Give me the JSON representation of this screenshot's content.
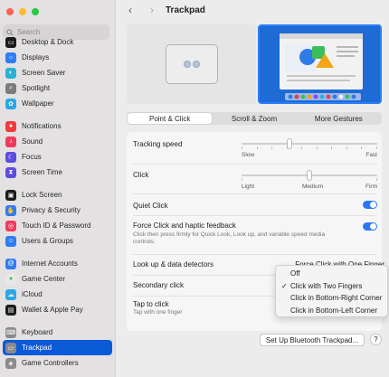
{
  "window": {
    "title": "Trackpad"
  },
  "sidebar": {
    "search_placeholder": "Search",
    "groups": [
      [
        {
          "label": "Desktop & Dock",
          "icon": "dock-icon",
          "color": "#1b1b1b"
        },
        {
          "label": "Displays",
          "icon": "display-icon",
          "color": "#2f7cf6"
        },
        {
          "label": "Screen Saver",
          "icon": "screensaver-icon",
          "color": "#29b2d6"
        },
        {
          "label": "Spotlight",
          "icon": "magnifier-icon",
          "color": "#7c7c7c"
        },
        {
          "label": "Wallpaper",
          "icon": "flower-icon",
          "color": "#2aa7e8"
        }
      ],
      [
        {
          "label": "Notifications",
          "icon": "bell-icon",
          "color": "#ef3b3b"
        },
        {
          "label": "Sound",
          "icon": "speaker-icon",
          "color": "#ef3b5a"
        },
        {
          "label": "Focus",
          "icon": "moon-icon",
          "color": "#5b4de0"
        },
        {
          "label": "Screen Time",
          "icon": "hourglass-icon",
          "color": "#5b4de0"
        }
      ],
      [
        {
          "label": "Lock Screen",
          "icon": "lock-screen-icon",
          "color": "#1b1b1b"
        },
        {
          "label": "Privacy & Security",
          "icon": "hand-icon",
          "color": "#2f7cf6"
        },
        {
          "label": "Touch ID & Password",
          "icon": "fingerprint-icon",
          "color": "#ef3b5a"
        },
        {
          "label": "Users & Groups",
          "icon": "users-icon",
          "color": "#2f7cf6"
        }
      ],
      [
        {
          "label": "Internet Accounts",
          "icon": "at-icon",
          "color": "#2f7cf6"
        },
        {
          "label": "Game Center",
          "icon": "game-center-icon",
          "color": "#e8e8e8"
        },
        {
          "label": "iCloud",
          "icon": "cloud-icon",
          "color": "#2aa7e8"
        },
        {
          "label": "Wallet & Apple Pay",
          "icon": "wallet-icon",
          "color": "#1b1b1b"
        }
      ],
      [
        {
          "label": "Keyboard",
          "icon": "keyboard-icon",
          "color": "#8a8a8a"
        },
        {
          "label": "Trackpad",
          "icon": "trackpad-icon",
          "color": "#8a8a8a",
          "active": true
        },
        {
          "label": "Game Controllers",
          "icon": "gamepad-icon",
          "color": "#8a8a8a"
        }
      ]
    ]
  },
  "tabs": [
    "Point & Click",
    "Scroll & Zoom",
    "More Gestures"
  ],
  "selected_tab": 0,
  "settings": {
    "tracking_speed": {
      "label": "Tracking speed",
      "min_label": "Slow",
      "max_label": "Fast",
      "value": 0.35
    },
    "click": {
      "label": "Click",
      "labels": [
        "Light",
        "Medium",
        "Firm"
      ],
      "value": 0.5
    },
    "quiet_click": {
      "label": "Quiet Click",
      "on": true
    },
    "force_click": {
      "label": "Force Click and haptic feedback",
      "sublabel": "Click then press firmly for Quick Look, Look up, and variable speed media controls.",
      "on": true
    },
    "lookup": {
      "label": "Look up & data detectors",
      "value": "Force Click with One Finger"
    },
    "secondary_click": {
      "label": "Secondary click"
    },
    "tap_to_click": {
      "label": "Tap to click",
      "sublabel": "Tap with one finger"
    }
  },
  "secondary_menu": {
    "options": [
      "Off",
      "Click with Two Fingers",
      "Click in Bottom-Right Corner",
      "Click in Bottom-Left Corner"
    ],
    "checked": 1,
    "check_glyph": "✓"
  },
  "buttons": {
    "bluetooth": "Set Up Bluetooth Trackpad...",
    "help": "?"
  },
  "nav": {
    "back": "‹",
    "forward": "›"
  },
  "colors": {
    "accent": "#2b78f6",
    "sidebar_active": "#0b5ad8"
  }
}
